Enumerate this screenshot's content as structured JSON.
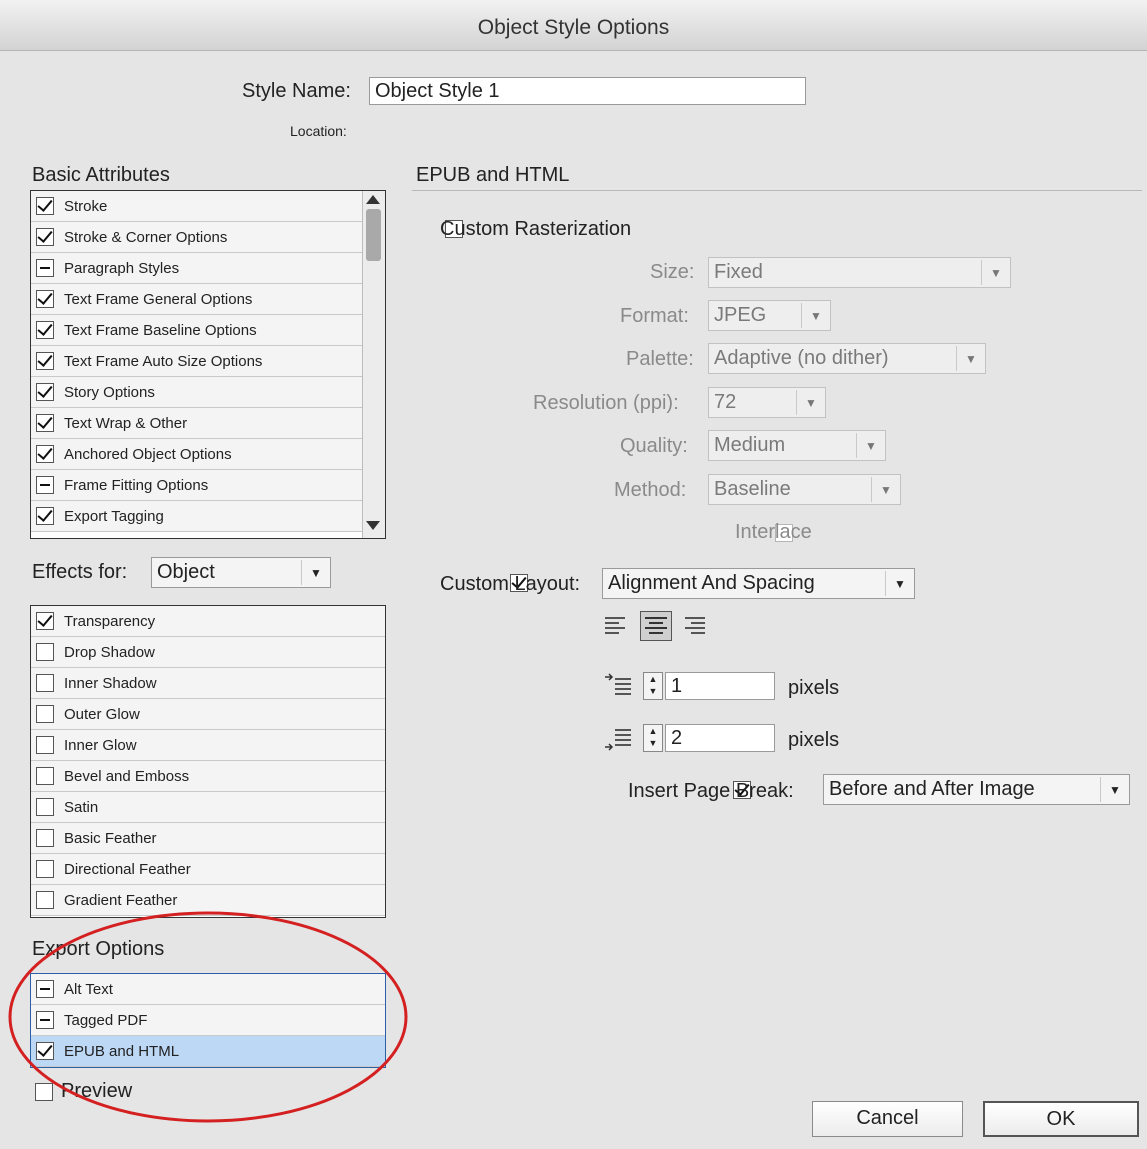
{
  "dialog_title": "Object Style Options",
  "style_name": {
    "label": "Style Name:",
    "value": "Object Style 1",
    "location_label": "Location:"
  },
  "basic_attributes": {
    "heading": "Basic Attributes",
    "items": [
      {
        "label": "Stroke",
        "state": "checked"
      },
      {
        "label": "Stroke & Corner Options",
        "state": "checked"
      },
      {
        "label": "Paragraph Styles",
        "state": "mixed"
      },
      {
        "label": "Text Frame General Options",
        "state": "checked"
      },
      {
        "label": "Text Frame Baseline Options",
        "state": "checked"
      },
      {
        "label": "Text Frame Auto Size Options",
        "state": "checked"
      },
      {
        "label": "Story Options",
        "state": "checked"
      },
      {
        "label": "Text Wrap & Other",
        "state": "checked"
      },
      {
        "label": "Anchored Object Options",
        "state": "checked"
      },
      {
        "label": "Frame Fitting Options",
        "state": "mixed"
      },
      {
        "label": "Export Tagging",
        "state": "checked"
      }
    ]
  },
  "effects": {
    "label": "Effects for:",
    "selected": "Object",
    "items": [
      {
        "label": "Transparency",
        "state": "checked"
      },
      {
        "label": "Drop Shadow",
        "state": "unchecked"
      },
      {
        "label": "Inner Shadow",
        "state": "unchecked"
      },
      {
        "label": "Outer Glow",
        "state": "unchecked"
      },
      {
        "label": "Inner Glow",
        "state": "unchecked"
      },
      {
        "label": "Bevel and Emboss",
        "state": "unchecked"
      },
      {
        "label": "Satin",
        "state": "unchecked"
      },
      {
        "label": "Basic Feather",
        "state": "unchecked"
      },
      {
        "label": "Directional Feather",
        "state": "unchecked"
      },
      {
        "label": "Gradient Feather",
        "state": "unchecked"
      }
    ]
  },
  "export_options": {
    "heading": "Export Options",
    "items": [
      {
        "label": "Alt Text",
        "state": "mixed"
      },
      {
        "label": "Tagged PDF",
        "state": "mixed"
      },
      {
        "label": "EPUB and HTML",
        "state": "checked",
        "selected": true
      }
    ]
  },
  "panel": {
    "heading": "EPUB and HTML",
    "custom_rasterization": {
      "label": "Custom Rasterization",
      "checked": false
    },
    "size": {
      "label": "Size:",
      "value": "Fixed"
    },
    "format": {
      "label": "Format:",
      "value": "JPEG"
    },
    "palette": {
      "label": "Palette:",
      "value": "Adaptive (no dither)"
    },
    "resolution": {
      "label": "Resolution (ppi):",
      "value": "72"
    },
    "quality": {
      "label": "Quality:",
      "value": "Medium"
    },
    "method": {
      "label": "Method:",
      "value": "Baseline"
    },
    "interlace": {
      "label": "Interlace",
      "checked": false
    },
    "custom_layout": {
      "label": "Custom Layout:",
      "checked": true,
      "value": "Alignment And Spacing"
    },
    "space_before": {
      "value": "1",
      "unit": "pixels"
    },
    "space_after": {
      "value": "2",
      "unit": "pixels"
    },
    "page_break": {
      "label": "Insert Page Break:",
      "checked": true,
      "value": "Before and After Image"
    }
  },
  "preview": {
    "label": "Preview",
    "checked": false
  },
  "buttons": {
    "cancel": "Cancel",
    "ok": "OK"
  },
  "colors": {
    "selection": "#bcd8f4",
    "annotation_circle": "#d42020"
  }
}
